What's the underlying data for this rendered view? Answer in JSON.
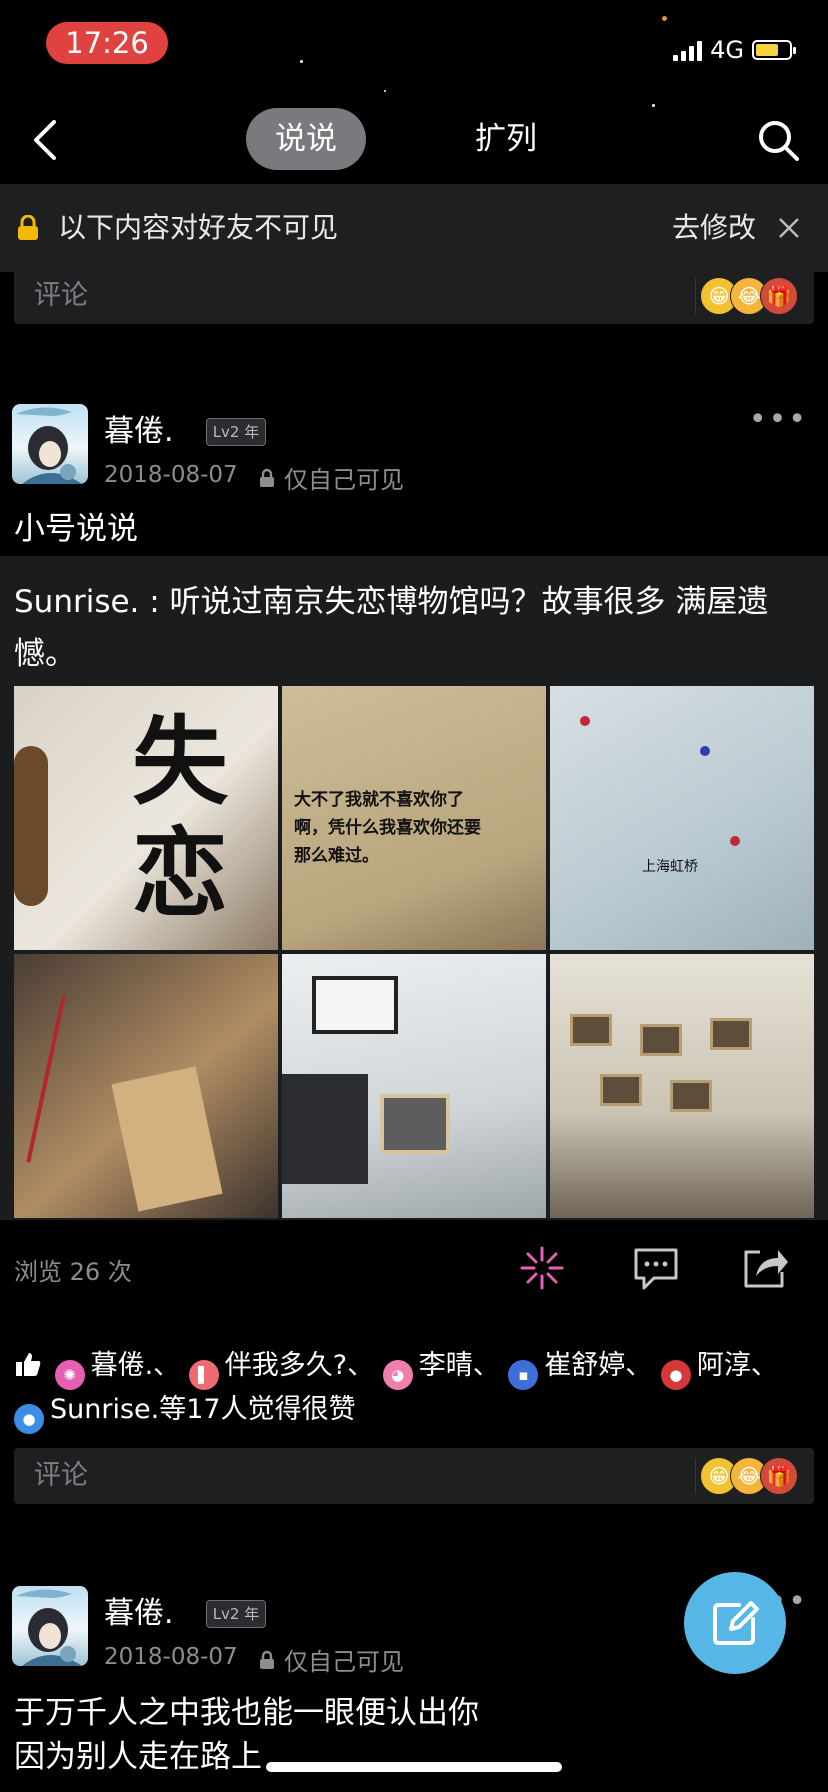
{
  "status_bar": {
    "time": "17:26",
    "network": "4G"
  },
  "nav": {
    "tab_active": "说说",
    "tab_other": "扩列"
  },
  "banner": {
    "message": "以下内容对好友不可见",
    "action": "去修改"
  },
  "comment_placeholder": "评论",
  "posts": [
    {
      "username": "暮倦.",
      "level": "Lv2",
      "level_suffix": "年",
      "date": "2018-08-07",
      "privacy": "仅自己可见",
      "text": "小号说说",
      "shared_text": "Sunrise. : 听说过南京失恋博物馆吗？故事很多 满屋遗憾。",
      "photo_captions": [
        "失恋",
        "大不了我就不喜欢你了啊，凭什么我喜欢你还要那么难过。",
        "上海虹桥",
        "",
        "",
        ""
      ],
      "views": "浏览 26 次",
      "likes_line1": [
        "暮倦.、",
        "伴我多久?、",
        "李晴、",
        "崔舒婷、",
        "阿淳、"
      ],
      "likes_line2": "Sunrise.等17人觉得很赞"
    },
    {
      "username": "暮倦.",
      "level": "Lv2",
      "level_suffix": "年",
      "date": "2018-08-07",
      "privacy": "仅自己可见",
      "text_lines": [
        "于万千人之中我也能一眼便认出你",
        "因为别人走在路上"
      ]
    }
  ],
  "colors": {
    "fab": "#56b7e6",
    "status_time_bg": "#e0433f",
    "like_icon": "#ffffff"
  },
  "icons": [
    "back-arrow-icon",
    "search-icon",
    "lock-icon",
    "close-icon",
    "more-icon",
    "firework-icon",
    "comment-icon",
    "share-icon",
    "thumbs-up-icon",
    "edit-icon"
  ]
}
